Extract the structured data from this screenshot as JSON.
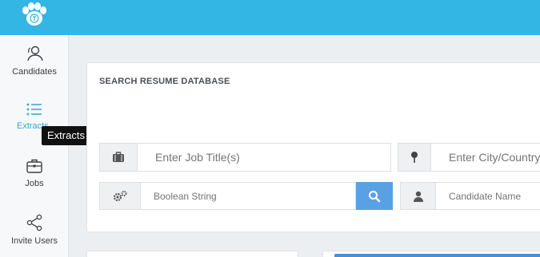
{
  "app": {
    "brand_color": "#34b6e4",
    "logo_icon": "paw-icon"
  },
  "sidebar": {
    "items": [
      {
        "label": "Candidates",
        "icon": "user-outline-icon"
      },
      {
        "label": "Extracts",
        "icon": "list-icon",
        "active": true
      },
      {
        "label": "Jobs",
        "icon": "briefcase-icon"
      },
      {
        "label": "Invite Users",
        "icon": "share-icon"
      }
    ],
    "tooltip": "Extracts"
  },
  "search_panel": {
    "title": "SEARCH RESUME DATABASE",
    "job_title": {
      "placeholder": "Enter Job Title(s)",
      "icon": "briefcase-icon"
    },
    "location": {
      "placeholder": "Enter City/Country",
      "icon": "map-pin-icon"
    },
    "boolean": {
      "placeholder": "Boolean String",
      "icon": "gears-icon"
    },
    "search_button": {
      "icon": "search-icon",
      "color": "#5aa1e3"
    },
    "candidate": {
      "placeholder": "Candidate Name",
      "icon": "user-icon"
    }
  }
}
